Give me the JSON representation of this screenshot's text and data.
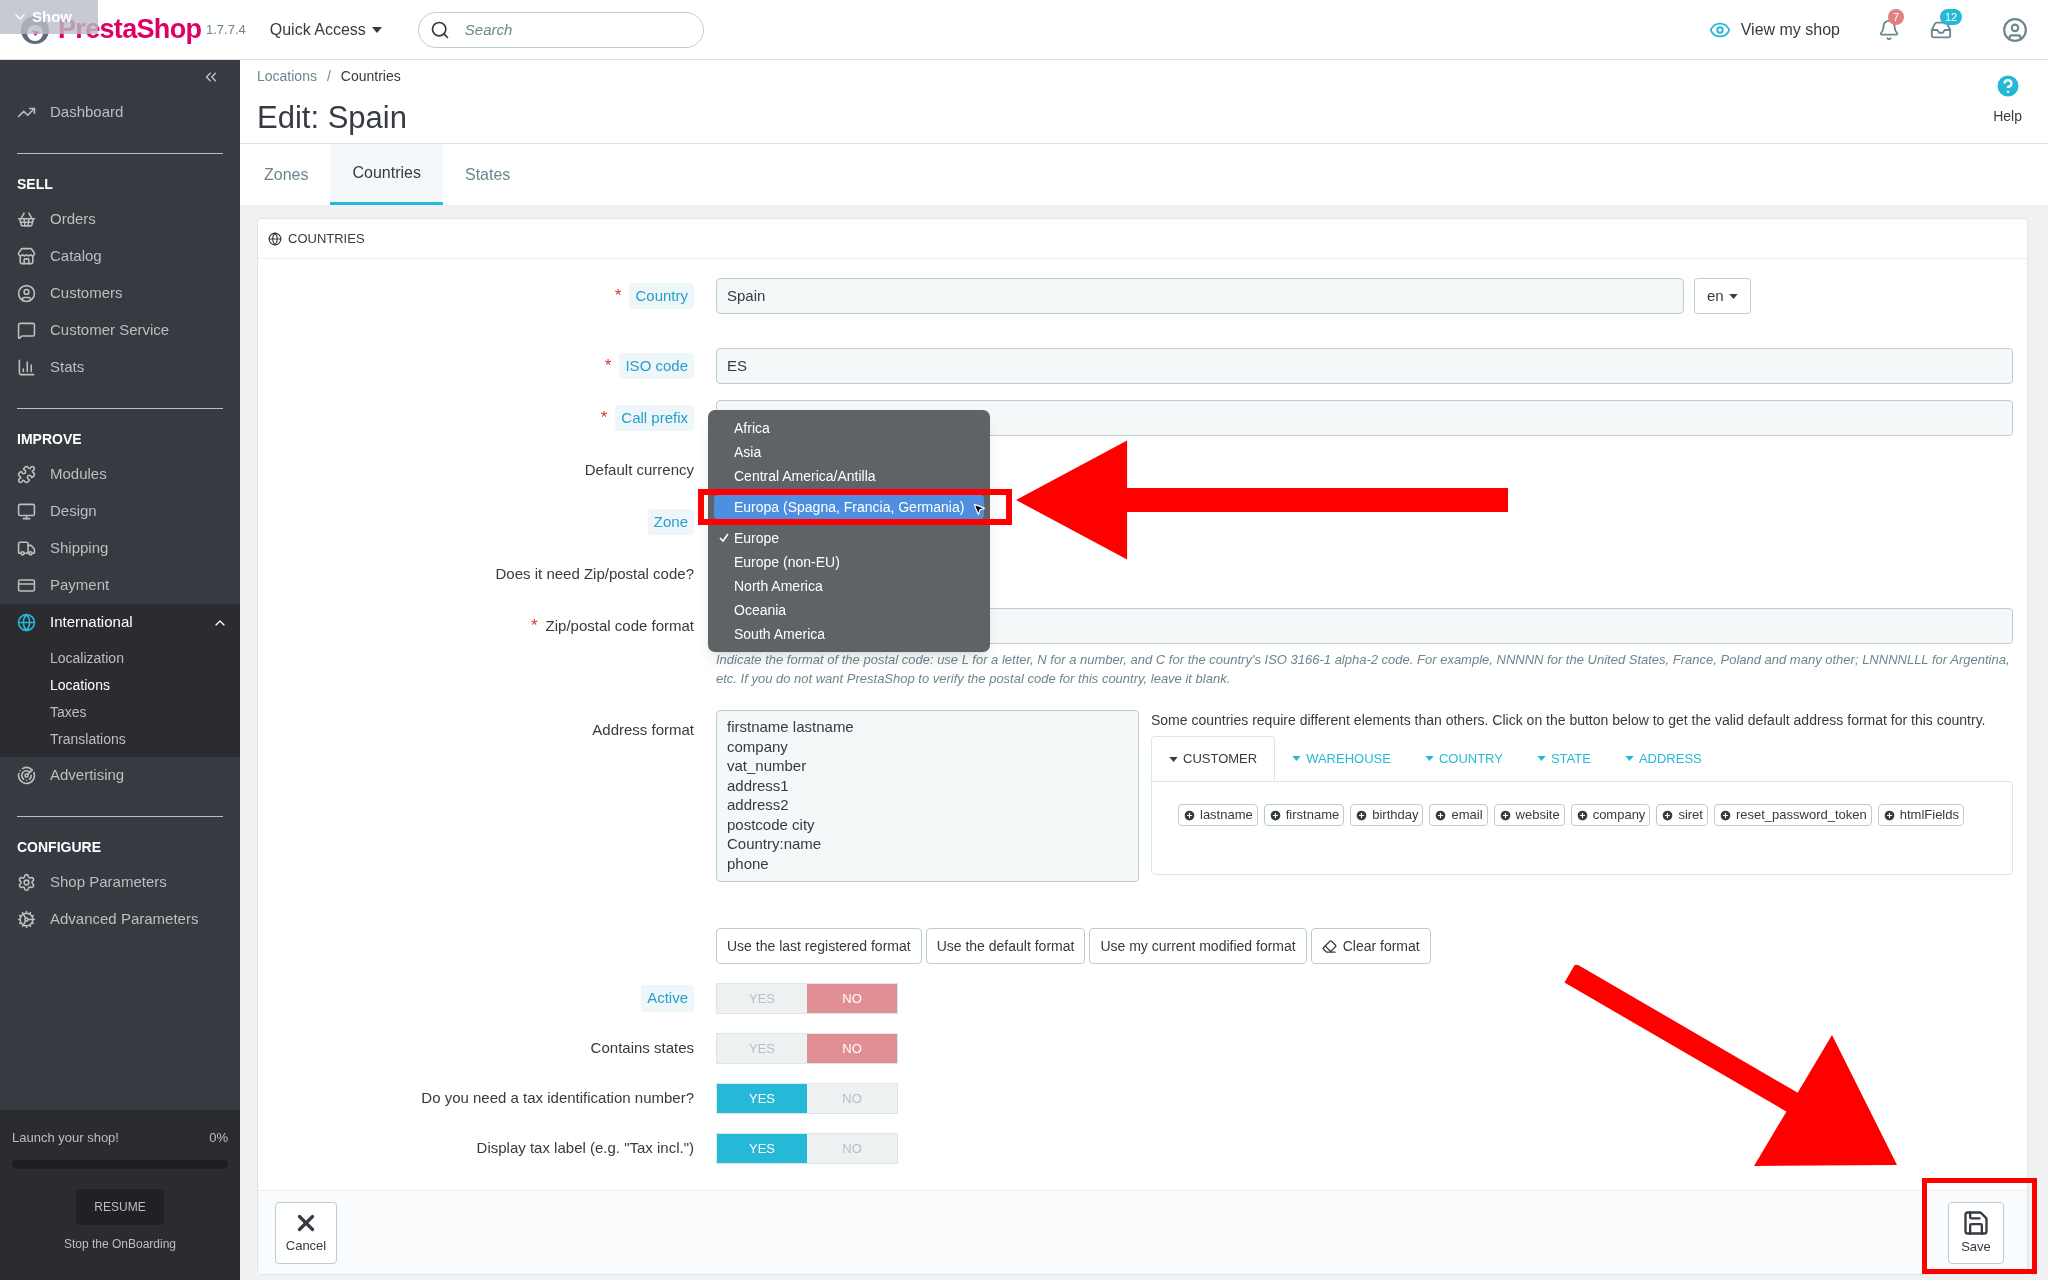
{
  "header": {
    "overlay_button": "Show",
    "logo": "PrestaShop",
    "version": "1.7.7.4",
    "quick_access": "Quick Access",
    "search_placeholder": "Search",
    "view_shop": "View my shop",
    "badges": [
      {
        "count": "7",
        "color": "#e08080"
      },
      {
        "count": "12",
        "color": "#25b9d7"
      }
    ]
  },
  "sidebar": {
    "top_items": [
      {
        "label": "Dashboard",
        "selected": false
      }
    ],
    "sections": [
      {
        "heading": "SELL",
        "items": [
          {
            "label": "Orders",
            "selected": false
          },
          {
            "label": "Catalog",
            "selected": false
          },
          {
            "label": "Customers",
            "selected": false
          },
          {
            "label": "Customer Service",
            "selected": false
          },
          {
            "label": "Stats",
            "selected": false
          }
        ]
      },
      {
        "heading": "IMPROVE",
        "items": [
          {
            "label": "Modules",
            "selected": false
          },
          {
            "label": "Design",
            "selected": false
          },
          {
            "label": "Shipping",
            "selected": false
          },
          {
            "label": "Payment",
            "selected": false
          },
          {
            "label": "International",
            "selected": true,
            "expanded": true,
            "children": [
              {
                "label": "Localization",
                "selected": false
              },
              {
                "label": "Locations",
                "selected": true
              },
              {
                "label": "Taxes",
                "selected": false
              },
              {
                "label": "Translations",
                "selected": false
              }
            ]
          },
          {
            "label": "Advertising",
            "selected": false
          }
        ]
      },
      {
        "heading": "CONFIGURE",
        "items": [
          {
            "label": "Shop Parameters",
            "selected": false
          },
          {
            "label": "Advanced Parameters",
            "selected": false
          }
        ]
      }
    ],
    "onboarding": {
      "title": "Launch your shop!",
      "percent": "0%",
      "level": 0,
      "button": "RESUME",
      "link": "Stop the OnBoarding"
    }
  },
  "breadcrumb": {
    "items": [
      "Locations",
      "Countries"
    ],
    "separator": "/"
  },
  "page_title": "Edit: Spain",
  "help": "Help",
  "tabs": [
    {
      "label": "Zones",
      "selected": false
    },
    {
      "label": "Countries",
      "selected": true
    },
    {
      "label": "States",
      "selected": false
    }
  ],
  "form": {
    "title": "COUNTRIES",
    "rows": [
      {
        "kind": "text",
        "label": "Country",
        "required": "*",
        "hint": true,
        "value": "Spain",
        "lang": "en"
      },
      {
        "kind": "text",
        "label": "ISO code",
        "required": "*",
        "hint": true,
        "value": "ES"
      },
      {
        "kind": "text",
        "label": "Call prefix",
        "required": "*",
        "hint": true
      },
      {
        "kind": "covered",
        "label": "Default currency",
        "hint": false
      },
      {
        "kind": "covered",
        "label": "Zone",
        "hint": true
      },
      {
        "kind": "covered",
        "label": "Does it need Zip/postal code?",
        "hint": false
      },
      {
        "kind": "text",
        "label": "Zip/postal code format",
        "required": "*",
        "hint": false,
        "help": "Indicate the format of the postal code: use L for a letter, N for a number, and C for the country's ISO 3166-1 alpha-2 code. For example, NNNNN for the United States, France, Poland and many other; LNNNNLLL for Argentina, etc. If you do not want PrestaShop to verify the postal code for this country, leave it blank."
      }
    ],
    "address": {
      "label": "Address format",
      "lines": [
        "firstname lastname",
        "company",
        "vat_number",
        "address1",
        "address2",
        "postcode city",
        "Country:name",
        "phone"
      ],
      "info": "Some countries require different elements than others. Click on the button below to get the valid default address format for this country.",
      "tabs": [
        {
          "label": "CUSTOMER",
          "selected": true
        },
        {
          "label": "WAREHOUSE",
          "selected": false
        },
        {
          "label": "COUNTRY",
          "selected": false
        },
        {
          "label": "STATE",
          "selected": false
        },
        {
          "label": "ADDRESS",
          "selected": false
        }
      ],
      "fields": [
        "lastname",
        "firstname",
        "birthday",
        "email",
        "website",
        "company",
        "siret",
        "reset_password_token",
        "htmlFields"
      ],
      "buttons": [
        {
          "label": "Use the last registered format",
          "kind": "plain"
        },
        {
          "label": "Use the default format",
          "kind": "plain"
        },
        {
          "label": "Use my current modified format",
          "kind": "plain"
        },
        {
          "label": "Clear format",
          "kind": "eraser"
        }
      ]
    },
    "switches": [
      {
        "label": "Active",
        "hint": true,
        "yes": "YES",
        "no": "NO",
        "on": false
      },
      {
        "label": "Contains states",
        "hint": false,
        "yes": "YES",
        "no": "NO",
        "on": false
      },
      {
        "label": "Do you need a tax identification number?",
        "hint": false,
        "yes": "YES",
        "no": "NO",
        "on": true
      },
      {
        "label": "Display tax label (e.g. \"Tax incl.\")",
        "hint": false,
        "yes": "YES",
        "no": "NO",
        "on": true
      }
    ],
    "cancel": "Cancel",
    "save": "Save"
  },
  "zone_dropdown": [
    {
      "label": "Africa",
      "selected": false,
      "checked": false
    },
    {
      "label": "Asia",
      "selected": false,
      "checked": false
    },
    {
      "label": "Central America/Antilla",
      "selected": false,
      "checked": false
    },
    {
      "label": "Europa (Spagna, Francia, Germania)",
      "selected": true,
      "checked": false
    },
    {
      "label": "Europe",
      "selected": false,
      "checked": true
    },
    {
      "label": "Europe (non-EU)",
      "selected": false,
      "checked": false
    },
    {
      "label": "North America",
      "selected": false,
      "checked": false
    },
    {
      "label": "Oceania",
      "selected": false,
      "checked": false
    },
    {
      "label": "South America",
      "selected": false,
      "checked": false
    }
  ]
}
